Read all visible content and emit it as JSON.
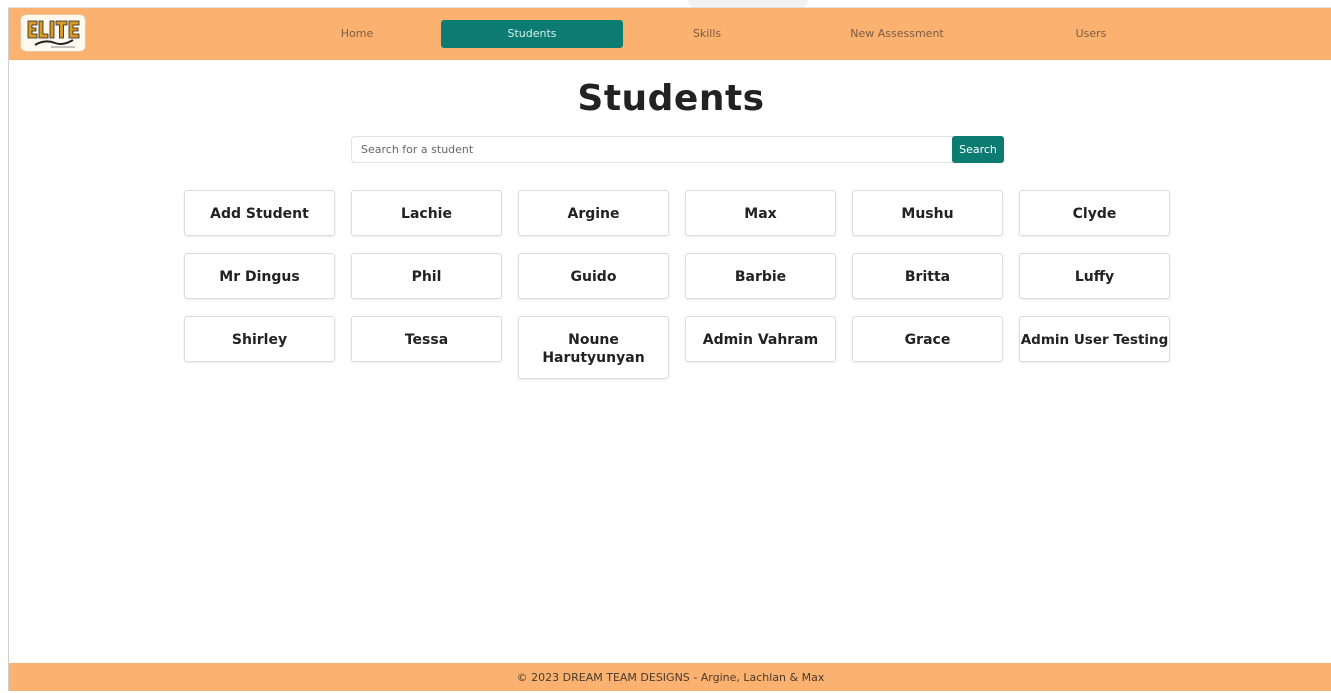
{
  "nav": {
    "logo_alt": "ELITE All-Stars",
    "items": [
      {
        "label": "Home",
        "active": false
      },
      {
        "label": "Students",
        "active": true
      },
      {
        "label": "Skills",
        "active": false
      },
      {
        "label": "New Assessment",
        "active": false
      },
      {
        "label": "Users",
        "active": false
      }
    ]
  },
  "page": {
    "title": "Students"
  },
  "search": {
    "placeholder": "Search for a student",
    "value": "",
    "button_label": "Search"
  },
  "students": [
    "Add Student",
    "Lachie",
    "Argine",
    "Max",
    "Mushu",
    "Clyde",
    "Mr Dingus",
    "Phil",
    "Guido",
    "Barbie",
    "Britta",
    "Luffy",
    "Shirley",
    "Tessa",
    "Noune Harutyunyan",
    "Admin Vahram",
    "Grace",
    "Admin User Testing"
  ],
  "footer": {
    "text": "© 2023 DREAM TEAM DESIGNS - Argine, Lachlan & Max"
  },
  "colors": {
    "navbar": "#fbb170",
    "accent": "#0c7b72"
  }
}
